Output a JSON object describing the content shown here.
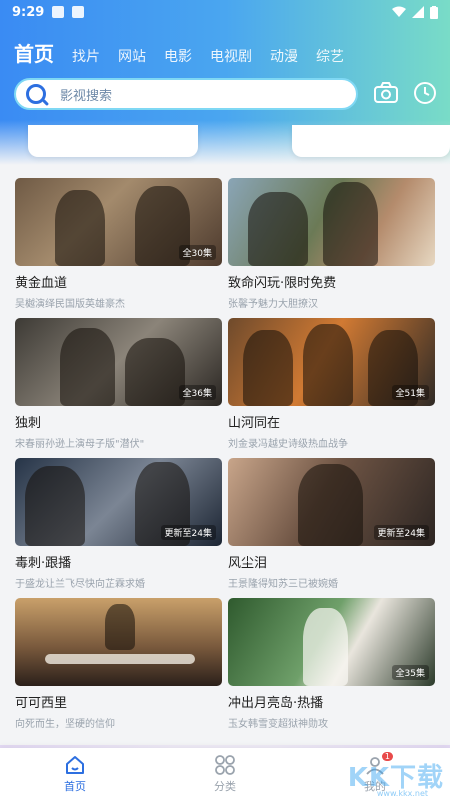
{
  "status": {
    "time": "9:29"
  },
  "tabs": [
    {
      "label": "首页",
      "active": true
    },
    {
      "label": "找片"
    },
    {
      "label": "网站"
    },
    {
      "label": "电影"
    },
    {
      "label": "电视剧"
    },
    {
      "label": "动漫"
    },
    {
      "label": "综艺"
    }
  ],
  "search": {
    "placeholder": "影视搜索"
  },
  "icons": {
    "camera": "camera-icon",
    "history": "history-icon",
    "search": "search-icon"
  },
  "cards": [
    {
      "title": "黄金血道",
      "desc": "吴樾演绎民国版英雄豪杰",
      "badge": "全30集"
    },
    {
      "title": "致命闪玩·限时免费",
      "desc": "张馨予魅力大胆撩汉",
      "badge": ""
    },
    {
      "title": "独刺",
      "desc": "宋春丽孙逊上演母子版\"潜伏\"",
      "badge": "全36集"
    },
    {
      "title": "山河同在",
      "desc": "刘金录冯越史诗级热血战争",
      "badge": "全51集"
    },
    {
      "title": "毒刺·跟播",
      "desc": "于盛龙让兰飞尽快向芷霖求婚",
      "badge": "更新至24集"
    },
    {
      "title": "风尘泪",
      "desc": "王景隆得知苏三已被婉婚",
      "badge": "更新至24集"
    },
    {
      "title": "可可西里",
      "desc": "向死而生，坚硬的信仰",
      "badge": ""
    },
    {
      "title": "冲出月亮岛·热播",
      "desc": "玉女韩雪变超狱神勋攻",
      "badge": "全35集"
    }
  ],
  "nav": [
    {
      "label": "首页",
      "active": true,
      "icon": "home-icon"
    },
    {
      "label": "分类",
      "icon": "category-icon"
    },
    {
      "label": "我的",
      "icon": "profile-icon",
      "badge": "1"
    }
  ],
  "watermark": {
    "text": "KK下载",
    "url": "www.kkx.net"
  },
  "colors": {
    "accent": "#2d6fe0",
    "header_start": "#3a8bf3",
    "header_end": "#79dcc7"
  }
}
